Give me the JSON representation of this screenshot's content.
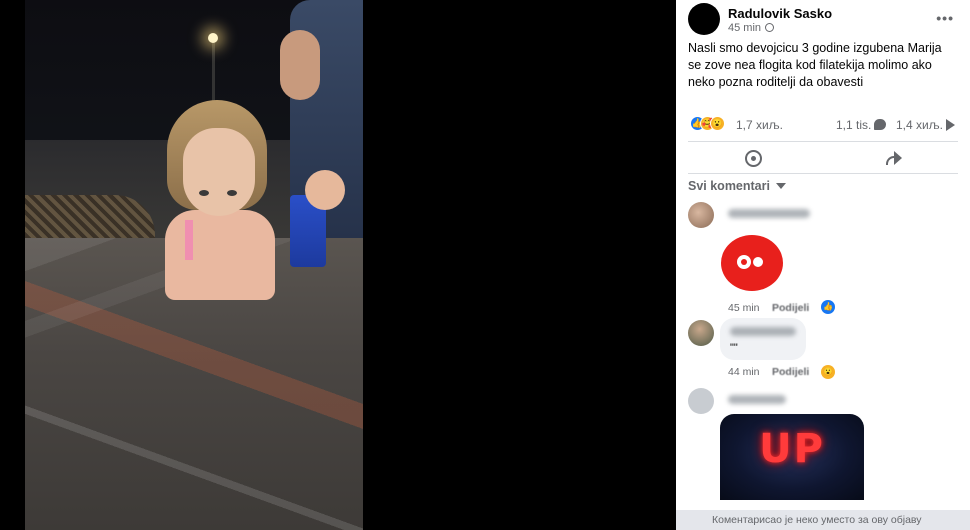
{
  "post": {
    "author": "Radulovik Sasko",
    "time": "45 min",
    "more": "•••",
    "text": "Nasli smo devojcicu 3 godine izgubena Marija se zove nea flogita kod filatekija molimo ako neko pozna roditelji da obavesti"
  },
  "stats": {
    "reactions": "1,7 хиљ.",
    "comments": "1,1 tis.",
    "shares": "1,4 хиљ."
  },
  "comments_filter": "Svi komentari",
  "comments": [
    {
      "time": "45 min",
      "share": "Podijeli",
      "reaction": "like"
    },
    {
      "text": "\"\"",
      "time": "44 min",
      "share": "Podijeli",
      "reaction": "wow"
    },
    {
      "gif_text": "UP"
    }
  ],
  "bottom_notice": "Коментарисао је неко уместо за ову објаву",
  "colors": {
    "like": "#1877f2",
    "wow": "#f7b125",
    "sticker": "#e8201c",
    "gif_text": "#ff3b3b"
  }
}
